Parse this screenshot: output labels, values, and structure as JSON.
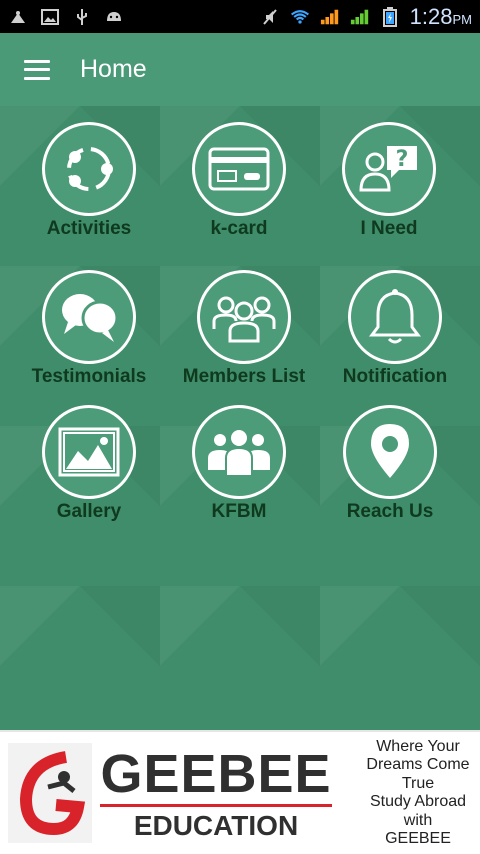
{
  "status_bar": {
    "time": "1:28",
    "ampm": "PM",
    "left_icons": [
      "app-notification-icon",
      "image-icon",
      "usb-icon",
      "android-icon"
    ],
    "right_icons": [
      "mute-icon",
      "wifi-icon",
      "signal-icon",
      "signal-icon",
      "battery-charging-icon"
    ]
  },
  "app_bar": {
    "title": "Home"
  },
  "tiles": [
    {
      "label": "Activities",
      "icon": "share-network-icon"
    },
    {
      "label": "k-card",
      "icon": "credit-card-icon"
    },
    {
      "label": "I Need",
      "icon": "question-chat-icon"
    },
    {
      "label": "Testimonials",
      "icon": "chat-bubbles-icon"
    },
    {
      "label": "Members List",
      "icon": "group-icon"
    },
    {
      "label": "Notification",
      "icon": "bell-icon"
    },
    {
      "label": "Gallery",
      "icon": "picture-icon"
    },
    {
      "label": "KFBM",
      "icon": "people-icon"
    },
    {
      "label": "Reach Us",
      "icon": "location-pin-icon"
    }
  ],
  "banner": {
    "brand": "GEEBEE",
    "subtitle": "EDUCATION",
    "tagline": [
      "Where Your",
      "Dreams Come",
      "True",
      "Study Abroad",
      "with",
      "GEEBEE"
    ]
  },
  "colors": {
    "background": "#3f8d6a",
    "app_bar": "#4a9a78",
    "label": "#0f3a1f",
    "brand_red": "#d8232a"
  }
}
